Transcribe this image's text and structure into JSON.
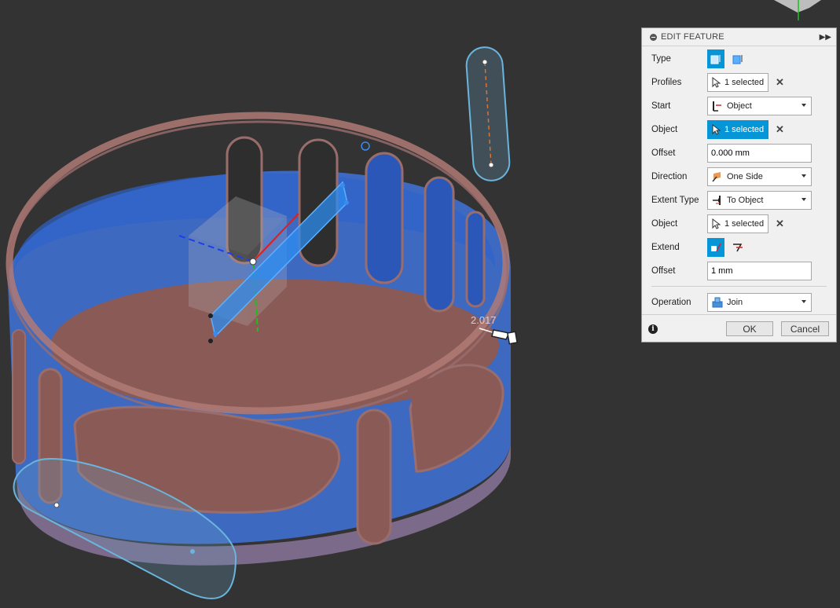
{
  "viewport": {
    "dimension_label": "2.017"
  },
  "panel": {
    "title": "EDIT FEATURE",
    "rows": {
      "type": {
        "label": "Type"
      },
      "profiles": {
        "label": "Profiles",
        "value": "1 selected"
      },
      "start": {
        "label": "Start",
        "value": "Object"
      },
      "start_object": {
        "label": "Object",
        "value": "1 selected"
      },
      "offset": {
        "label": "Offset",
        "value": "0.000 mm"
      },
      "direction": {
        "label": "Direction",
        "value": "One Side"
      },
      "extent_type": {
        "label": "Extent Type",
        "value": "To Object"
      },
      "extent_object": {
        "label": "Object",
        "value": "1 selected"
      },
      "extend": {
        "label": "Extend"
      },
      "extent_offset": {
        "label": "Offset",
        "value": "1 mm"
      },
      "operation": {
        "label": "Operation",
        "value": "Join"
      }
    },
    "ok_label": "OK",
    "cancel_label": "Cancel"
  },
  "colors": {
    "viewport_bg": "#333333",
    "accent": "#0696d7",
    "body_blue": "#3f6fd0",
    "floor_pink": "#8a5a57"
  }
}
